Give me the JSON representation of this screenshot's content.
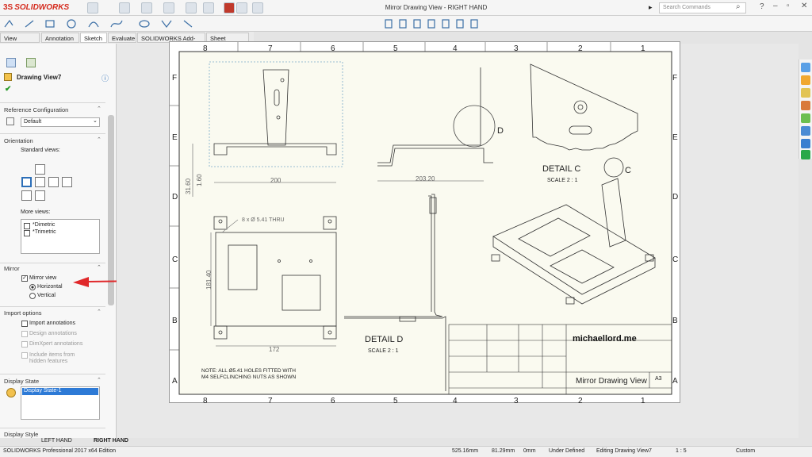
{
  "app": {
    "logo": "SOLIDWORKS",
    "title": "Mirror Drawing View - RIGHT HAND",
    "search_placeholder": "Search Commands"
  },
  "tabs": [
    "View Layout",
    "Annotation",
    "Sketch",
    "Evaluate",
    "SOLIDWORKS Add-Ins",
    "Sheet Format"
  ],
  "panel": {
    "title": "Drawing View7",
    "ref_config_header": "Reference Configuration",
    "ref_config_value": "Default",
    "orientation_header": "Orientation",
    "standard_views": "Standard views:",
    "more_views": "More views:",
    "more_views_items": [
      "*Dimetric",
      "*Trimetric"
    ],
    "mirror_header": "Mirror",
    "mirror_view": "Mirror view",
    "horizontal": "Horizontal",
    "vertical": "Vertical",
    "import_header": "Import options",
    "import_annotations": "Import annotations",
    "design_annotations": "Design annotations",
    "dimxpert": "DimXpert annotations",
    "hidden_features": "Include items from hidden features",
    "display_state_header": "Display State",
    "display_state_value": "Display State-1",
    "display_style_header": "Display Style"
  },
  "sheet_tabs": {
    "left": "LEFT HAND",
    "right": "RIGHT HAND"
  },
  "drawing": {
    "col_labels": [
      "8",
      "7",
      "6",
      "5",
      "4",
      "3",
      "2",
      "1"
    ],
    "row_labels": [
      "F",
      "E",
      "D",
      "C",
      "B",
      "A"
    ],
    "dims": {
      "d200": "200",
      "d31": "31.60",
      "d1": "1.60",
      "d203": "203.20",
      "d172": "172",
      "d181": "181.40",
      "holes": "8 x Ø 5.41 THRU"
    },
    "detail_c": "DETAIL C",
    "detail_d": "DETAIL D",
    "scale": "SCALE 2 : 1",
    "label_c": "C",
    "label_d": "D",
    "note_line1": "NOTE: ALL Ø5.41 HOLES FITTED WITH",
    "note_line2": "M4 SELFCLINCHING NUTS AS SHOWN",
    "tb_company": "michaellord.me",
    "tb_title": "Mirror Drawing View",
    "tb_size": "A3"
  },
  "status": {
    "edition": "SOLIDWORKS Professional 2017 x64 Edition",
    "x": "525.16mm",
    "y": "81.29mm",
    "z": "0mm",
    "state": "Under Defined",
    "editing": "Editing Drawing View7",
    "scale": "1 : 5",
    "units": "Custom"
  },
  "colors": {
    "accent": "#d52b1e",
    "selection": "#2d7ad6",
    "arrow": "#e0282a"
  }
}
